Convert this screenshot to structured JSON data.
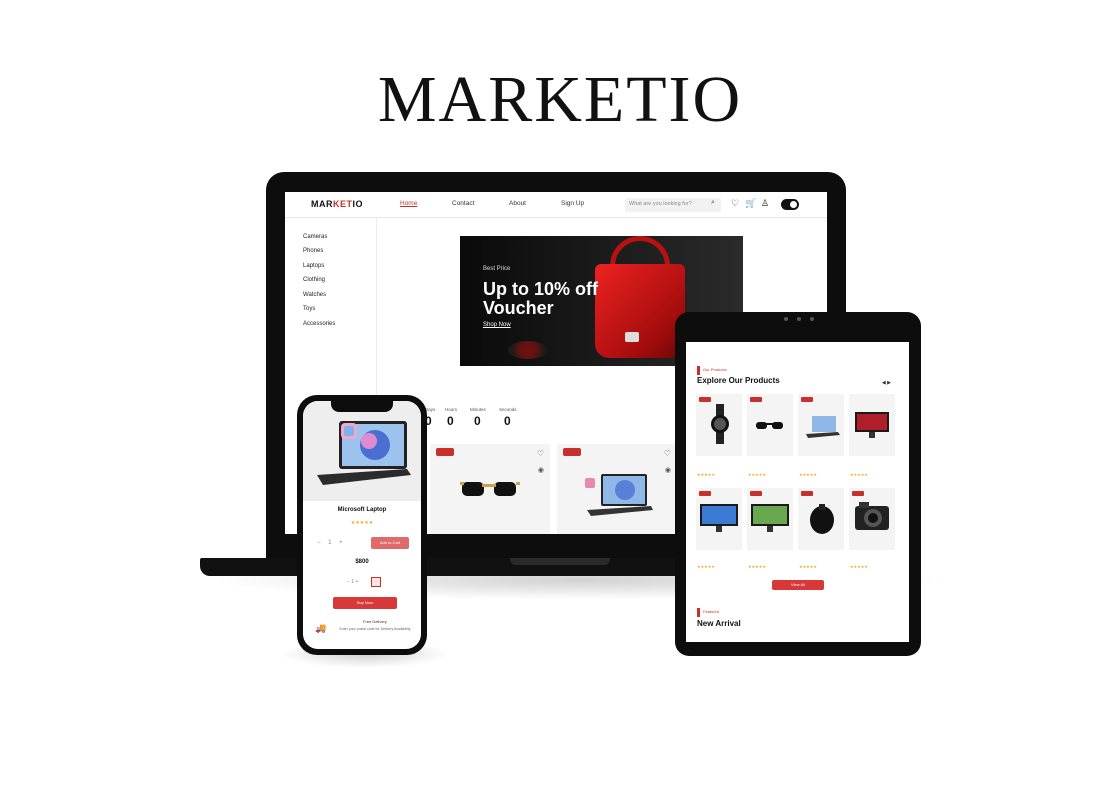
{
  "brand": {
    "title": "MARKETIO"
  },
  "laptop": {
    "nav": {
      "logo_black_1": "MAR",
      "logo_red": "KET",
      "logo_black_2": "IO",
      "links": [
        "Home",
        "Contact",
        "About",
        "Sign Up"
      ],
      "search_placeholder": "What are you looking for?"
    },
    "categories": [
      "Cameras",
      "Phones",
      "Laptops",
      "Clothing",
      "Watches",
      "Toys",
      "Accessories"
    ],
    "hero": {
      "small": "Best Price",
      "headline": "Up to 10% off Voucher",
      "link": "Shop Now"
    },
    "countdown": {
      "labels": [
        "Days",
        "Hours",
        "Minutes",
        "Seconds"
      ],
      "values": [
        "0",
        "0",
        "0",
        "0"
      ]
    }
  },
  "tablet": {
    "section_tag": "Our Products",
    "section_title": "Explore Our Products",
    "view_all": "View All",
    "section2_tag": "Featured",
    "section2_title": "New Arrival"
  },
  "phone": {
    "product_title": "Microsoft Laptop",
    "stars": "★★★★★",
    "qty": "− 1 +",
    "add_to_cart": "Add to Cart",
    "price": "$800",
    "buy": "Buy Now",
    "delivery_title": "Free Delivery",
    "delivery_text": "Enter your postal code for Delivery Availability"
  },
  "colors": {
    "accent": "#c8312b",
    "button": "#d93838",
    "dark": "#0d0d0d"
  }
}
